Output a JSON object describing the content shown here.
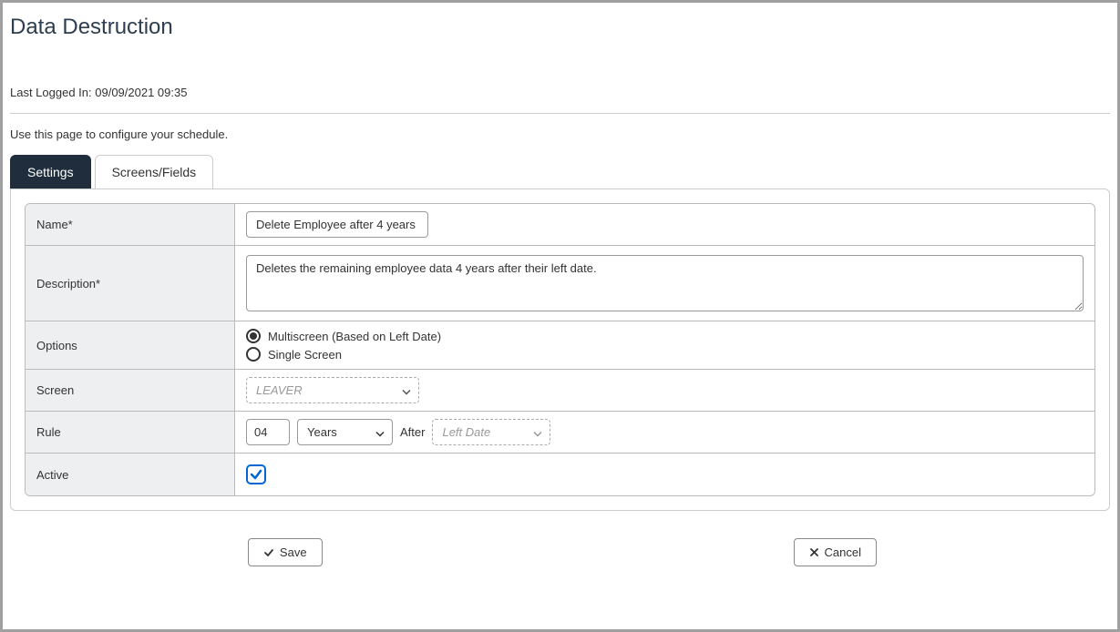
{
  "page": {
    "title": "Data Destruction",
    "last_login_label": "Last Logged In: 09/09/2021 09:35",
    "config_text": "Use this page to configure your schedule."
  },
  "tabs": {
    "settings": "Settings",
    "screens": "Screens/Fields"
  },
  "form": {
    "name": {
      "label": "Name*",
      "value": "Delete Employee after 4 years"
    },
    "description": {
      "label": "Description*",
      "value": "Deletes the remaining employee data 4 years after their left date."
    },
    "options": {
      "label": "Options",
      "multiscreen": "Multiscreen (Based on Left Date)",
      "single": "Single Screen",
      "selected": "multiscreen"
    },
    "screen": {
      "label": "Screen",
      "placeholder": "LEAVER"
    },
    "rule": {
      "label": "Rule",
      "number": "04",
      "unit": "Years",
      "after": "After",
      "basis_placeholder": "Left Date"
    },
    "active": {
      "label": "Active",
      "checked": true
    }
  },
  "buttons": {
    "save": "Save",
    "cancel": "Cancel"
  }
}
